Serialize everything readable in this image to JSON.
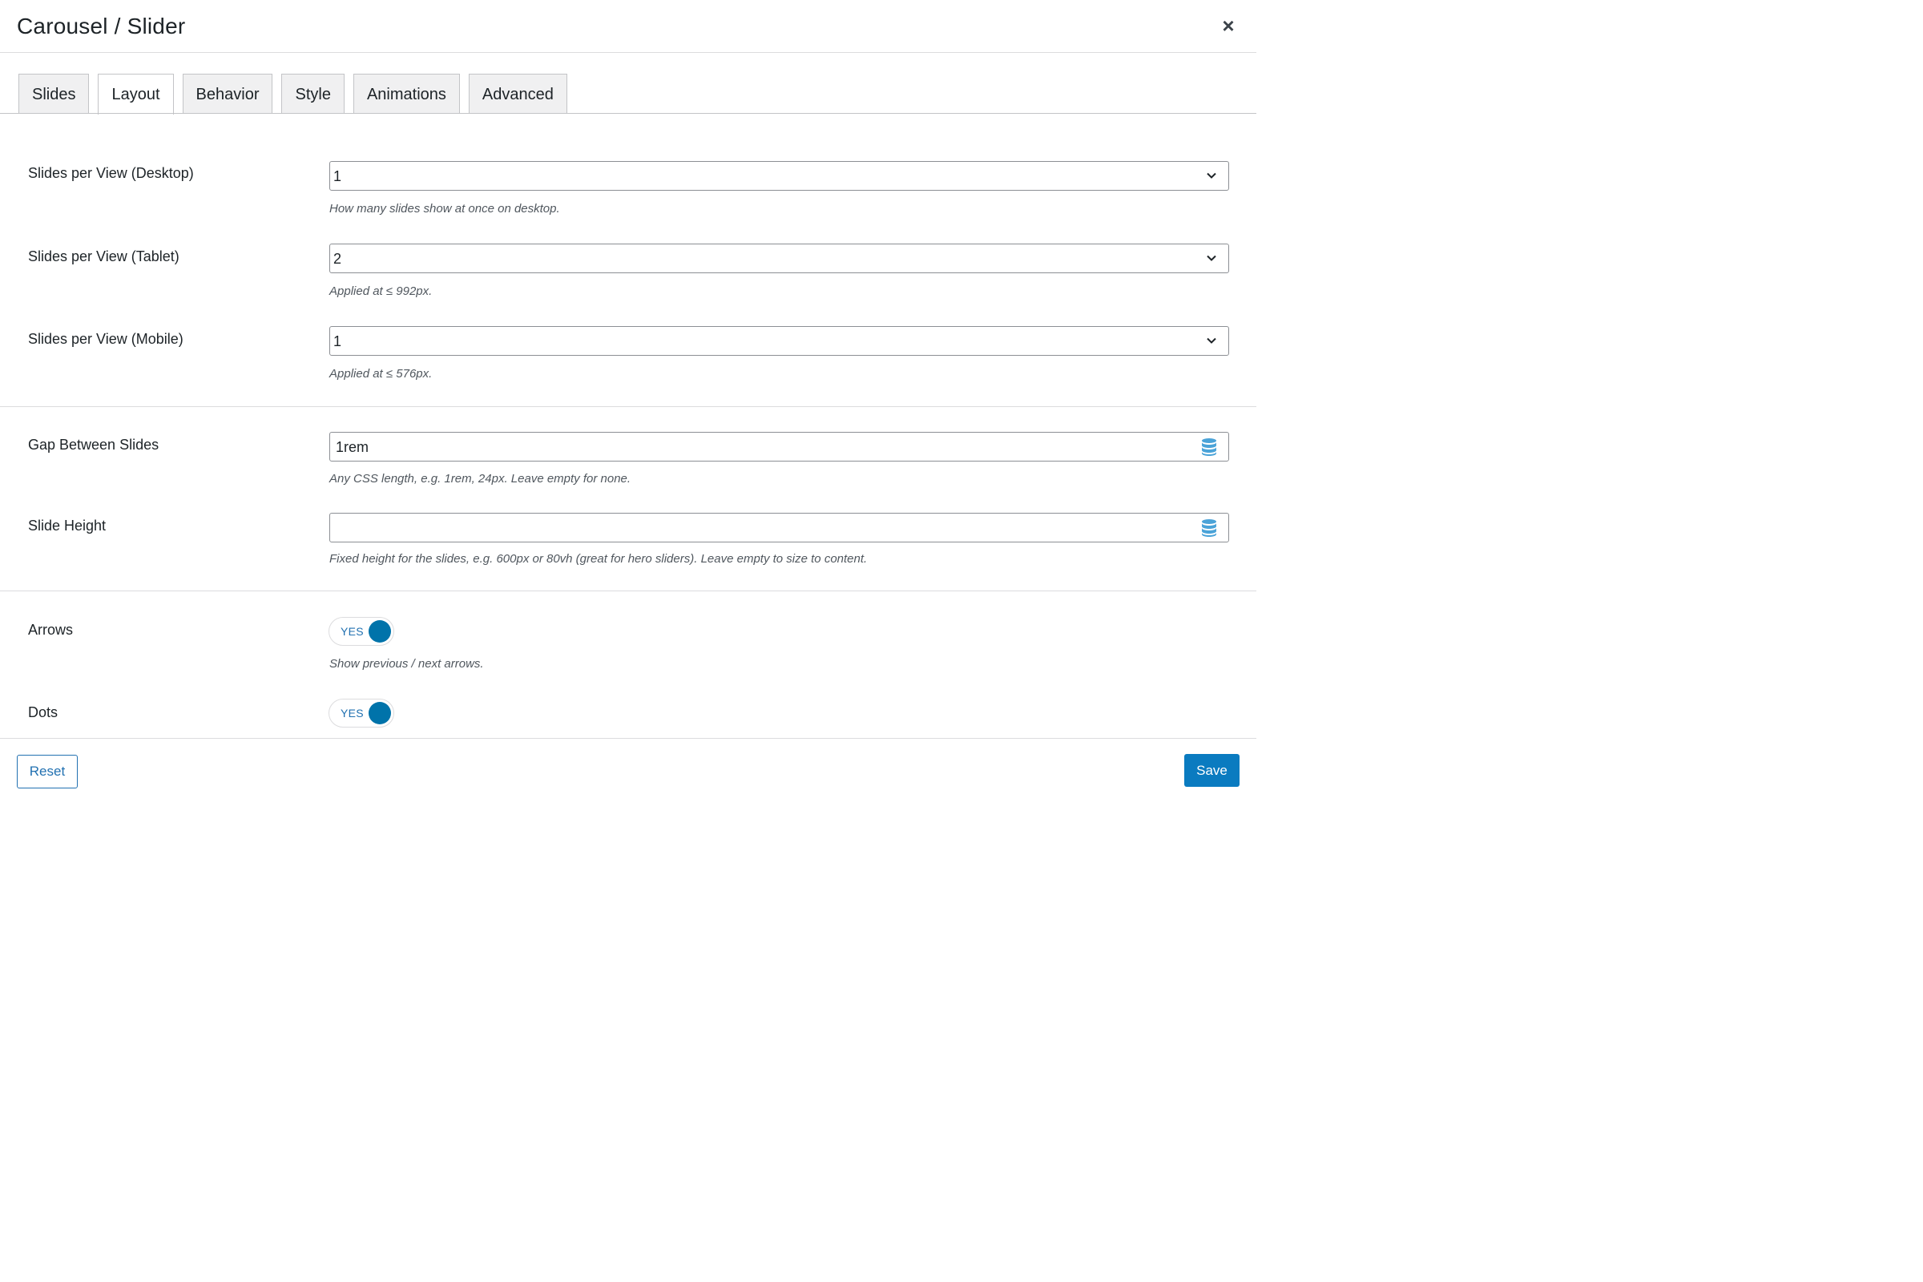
{
  "dialog": {
    "title": "Carousel / Slider",
    "close_glyph": "×"
  },
  "tabs": [
    {
      "label": "Slides",
      "active": false
    },
    {
      "label": "Layout",
      "active": true
    },
    {
      "label": "Behavior",
      "active": false
    },
    {
      "label": "Style",
      "active": false
    },
    {
      "label": "Animations",
      "active": false
    },
    {
      "label": "Advanced",
      "active": false
    }
  ],
  "fields": {
    "desktop": {
      "label": "Slides per View (Desktop)",
      "value": "1",
      "help": "How many slides show at once on desktop."
    },
    "tablet": {
      "label": "Slides per View (Tablet)",
      "value": "2",
      "help": "Applied at ≤ 992px."
    },
    "mobile": {
      "label": "Slides per View (Mobile)",
      "value": "1",
      "help": "Applied at ≤ 576px."
    },
    "gap": {
      "label": "Gap Between Slides",
      "value": "1rem",
      "help": "Any CSS length, e.g. 1rem, 24px. Leave empty for none."
    },
    "height": {
      "label": "Slide Height",
      "value": "",
      "help": "Fixed height for the slides, e.g. 600px or 80vh (great for hero sliders). Leave empty to size to content."
    },
    "arrows": {
      "label": "Arrows",
      "toggle": "YES",
      "help": "Show previous / next arrows."
    },
    "dots": {
      "label": "Dots",
      "toggle": "YES"
    }
  },
  "footer": {
    "reset_label": "Reset",
    "save_label": "Save"
  },
  "colors": {
    "accent": "#0073aa",
    "save_bg": "#0a7bc0",
    "link": "#2271b1",
    "db_icon": "#4aa3d8"
  },
  "icons": {
    "close": "close-icon",
    "select": "chevron-down-icon",
    "dynamic_data": "database-icon"
  }
}
